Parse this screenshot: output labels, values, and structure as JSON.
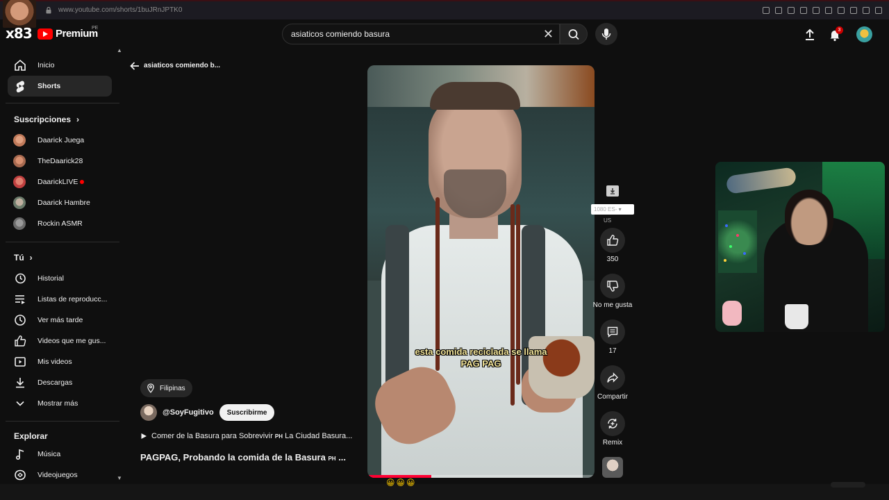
{
  "browser": {
    "url": "www.youtube.com/shorts/1buJRnJPTK0"
  },
  "overlay": {
    "streamer_tag": "x83"
  },
  "header": {
    "logo_text": "Premium",
    "country_code": "PE",
    "search_value": "asiaticos comiendo basura",
    "notifications_count": "3"
  },
  "sidebar": {
    "main": [
      {
        "label": "Inicio",
        "icon": "home-icon"
      },
      {
        "label": "Shorts",
        "icon": "shorts-icon",
        "active": true
      }
    ],
    "subscriptions_title": "Suscripciones",
    "subscriptions": [
      {
        "label": "Daarick Juega",
        "color": "#c07a5a"
      },
      {
        "label": "TheDaarick28",
        "color": "#a86a50"
      },
      {
        "label": "DaarickLIVE",
        "color": "#c04040",
        "live": true
      },
      {
        "label": "Daarick Hambre",
        "color": "#8a8a7a"
      },
      {
        "label": "Rockin ASMR",
        "color": "#7a7a7a"
      }
    ],
    "you_title": "Tú",
    "you": [
      {
        "label": "Historial",
        "icon": "history-icon"
      },
      {
        "label": "Listas de reproducc...",
        "icon": "playlist-icon"
      },
      {
        "label": "Ver más tarde",
        "icon": "clock-icon"
      },
      {
        "label": "Videos que me gus...",
        "icon": "thumbs-up-icon"
      },
      {
        "label": "Mis videos",
        "icon": "my-videos-icon"
      },
      {
        "label": "Descargas",
        "icon": "download-icon"
      },
      {
        "label": "Mostrar más",
        "icon": "chevron-down-icon"
      }
    ],
    "explore_title": "Explorar",
    "explore": [
      {
        "label": "Música",
        "icon": "music-icon"
      },
      {
        "label": "Videojuegos",
        "icon": "gamepad-icon"
      }
    ]
  },
  "page": {
    "back_title": "asiaticos comiendo b..."
  },
  "short": {
    "location": "Filipinas",
    "channel": "@SoyFugitivo",
    "subscribe_label": "Suscribirme",
    "playlist_text": "Comer de la Basura para Sobrevivir",
    "playlist_flag": "PH",
    "playlist_suffix": "La Ciudad Basura...",
    "title_text": "PAGPAG, Probando la comida de la Basura",
    "title_flag": "PH",
    "title_suffix": "...",
    "caption_line1": "esta comida reciclada se llama",
    "caption_line2": "PAG PAG",
    "progress": 0.28
  },
  "actions": {
    "quality": "1080  ES-",
    "quality_region": "US",
    "likes": "350",
    "dislike_label": "No me gusta",
    "comments": "17",
    "share_label": "Compartir",
    "remix_label": "Remix"
  },
  "bottom": {
    "emoji": "😀😀😀"
  }
}
